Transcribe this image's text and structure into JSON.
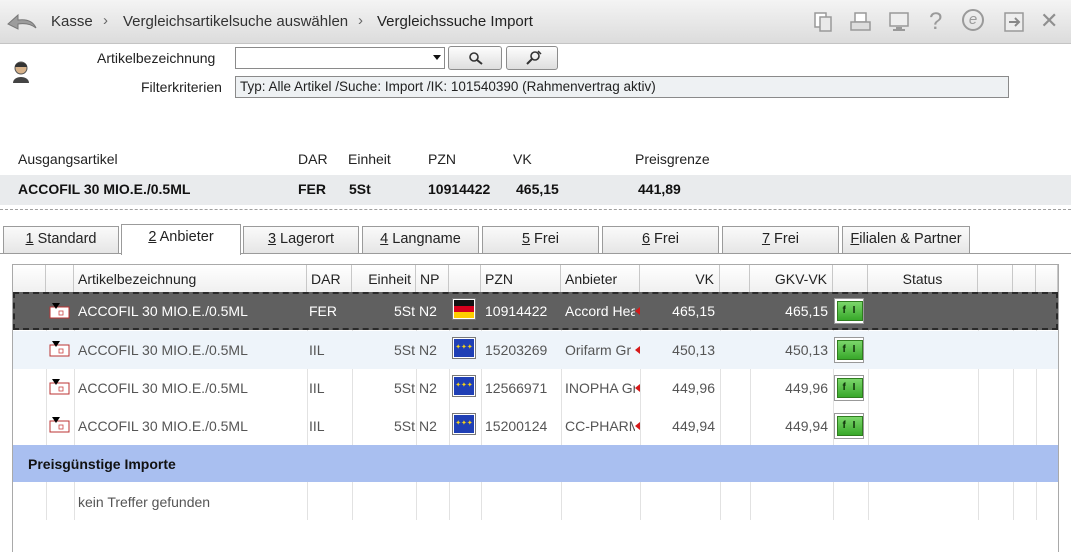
{
  "breadcrumb": {
    "items": [
      "Kasse",
      "Vergleichsartikelsuche auswählen",
      "Vergleichssuche Import"
    ],
    "separator": "›"
  },
  "toolbar": {
    "icons": [
      "back-arrow-icon",
      "copy-icon",
      "print-icon",
      "monitor-icon",
      "help-icon",
      "info-e-icon",
      "exit-icon",
      "close-icon"
    ],
    "help_glyph": "?",
    "close_glyph": "✕",
    "info_glyph": "e"
  },
  "search": {
    "artikel_label": "Artikelbezeichnung",
    "artikel_value": "",
    "filter_label": "Filterkriterien",
    "filter_value": "Typ: Alle Artikel /Suche: Import /IK: 101540390 (Rahmenvertrag aktiv)"
  },
  "original": {
    "headers": {
      "artikel": "Ausgangsartikel",
      "dar": "DAR",
      "einheit": "Einheit",
      "pzn": "PZN",
      "vk": "VK",
      "preisgrenze": "Preisgrenze"
    },
    "values": {
      "artikel": "ACCOFIL 30 MIO.E./0.5ML",
      "dar": "FER",
      "einheit": "5St",
      "pzn": "10914422",
      "vk": "465,15",
      "preisgrenze": "441,89"
    }
  },
  "tabs": [
    {
      "key": "1",
      "label": " Standard"
    },
    {
      "key": "2",
      "label": " Anbieter",
      "active": true
    },
    {
      "key": "3",
      "label": " Lagerort"
    },
    {
      "key": "4",
      "label": " Langname"
    },
    {
      "key": "5",
      "label": " Frei"
    },
    {
      "key": "6",
      "label": " Frei"
    },
    {
      "key": "7",
      "label": " Frei"
    },
    {
      "key": "F",
      "label": "ilialen & Partner"
    }
  ],
  "table": {
    "columns": {
      "artikel": "Artikelbezeichnung",
      "dar": "DAR",
      "einheit": "Einheit",
      "np": "NP",
      "pzn": "PZN",
      "anbieter": "Anbieter",
      "vk": "VK",
      "gkvvk": "GKV-VK",
      "status": "Status"
    },
    "rows": [
      {
        "artikel": "ACCOFIL 30 MIO.E./0.5ML",
        "dar": "FER",
        "einheit": "5St",
        "np": "N2",
        "flag": "de-flag",
        "pzn": "10914422",
        "anbieter": "Accord Hea",
        "vk": "465,15",
        "gkvvk": "465,15",
        "fi": "f I"
      },
      {
        "artikel": "ACCOFIL 30 MIO.E./0.5ML",
        "dar": "IIL",
        "einheit": "5St",
        "np": "N2",
        "flag": "eu-flag",
        "pzn": "15203269",
        "anbieter": "Orifarm Gr",
        "vk": "450,13",
        "gkvvk": "450,13",
        "fi": "f I"
      },
      {
        "artikel": "ACCOFIL 30 MIO.E./0.5ML",
        "dar": "IIL",
        "einheit": "5St",
        "np": "N2",
        "flag": "eu-flag",
        "pzn": "12566971",
        "anbieter": "INOPHA Gr",
        "vk": "449,96",
        "gkvvk": "449,96",
        "fi": "f I"
      },
      {
        "artikel": "ACCOFIL 30 MIO.E./0.5ML",
        "dar": "IIL",
        "einheit": "5St",
        "np": "N2",
        "flag": "eu-flag",
        "pzn": "15200124",
        "anbieter": "CC-PHARM",
        "vk": "449,94",
        "gkvvk": "449,94",
        "fi": "f I"
      }
    ],
    "section_title": "Preisgünstige Importe",
    "section_empty": "kein Treffer gefunden"
  },
  "colors": {
    "selected_row": "#606060",
    "alt_row": "#eef4fa",
    "section_band": "#a9bff0",
    "fi_button": "#38a82a"
  }
}
